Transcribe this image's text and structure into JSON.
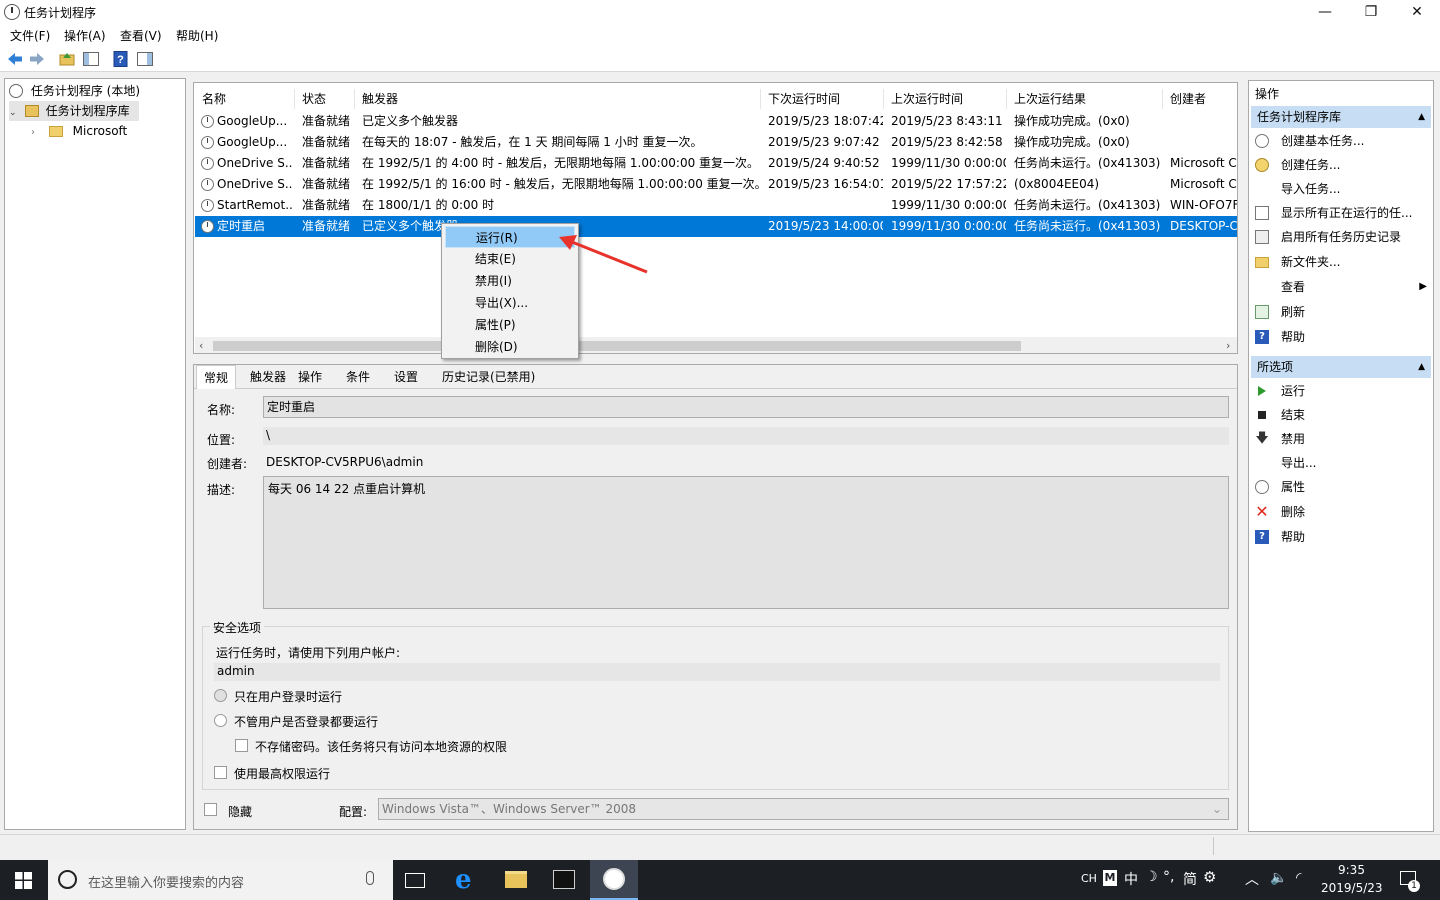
{
  "window": {
    "title": "任务计划程序",
    "min": "—",
    "max": "❐",
    "close": "✕"
  },
  "menu": [
    "文件(F)",
    "操作(A)",
    "查看(V)",
    "帮助(H)"
  ],
  "tree": {
    "root": "任务计划程序 (本地)",
    "library": "任务计划程序库",
    "child": "Microsoft"
  },
  "task_list": {
    "columns": [
      "名称",
      "状态",
      "触发器",
      "下次运行时间",
      "上次运行时间",
      "上次运行结果",
      "创建者"
    ],
    "rows": [
      {
        "name": "GoogleUp...",
        "status": "准备就绪",
        "trigger": "已定义多个触发器",
        "next": "2019/5/23 18:07:42",
        "last": "2019/5/23 8:43:11",
        "result": "操作成功完成。(0x0)",
        "author": ""
      },
      {
        "name": "GoogleUp...",
        "status": "准备就绪",
        "trigger": "在每天的 18:07 - 触发后，在 1 天 期间每隔 1 小时 重复一次。",
        "next": "2019/5/23 9:07:42",
        "last": "2019/5/23 8:42:58",
        "result": "操作成功完成。(0x0)",
        "author": ""
      },
      {
        "name": "OneDrive S...",
        "status": "准备就绪",
        "trigger": "在 1992/5/1 的 4:00 时 - 触发后，无限期地每隔 1.00:00:00 重复一次。",
        "next": "2019/5/24 9:40:52",
        "last": "1999/11/30 0:00:00",
        "result": "任务尚未运行。(0x41303)",
        "author": "Microsoft C"
      },
      {
        "name": "OneDrive S...",
        "status": "准备就绪",
        "trigger": "在 1992/5/1 的 16:00 时 - 触发后，无限期地每隔 1.00:00:00 重复一次。",
        "next": "2019/5/23 16:54:01",
        "last": "2019/5/22 17:57:22",
        "result": "(0x8004EE04)",
        "author": "Microsoft C"
      },
      {
        "name": "StartRemot...",
        "status": "准备就绪",
        "trigger": "在 1800/1/1 的 0:00 时",
        "next": "",
        "last": "1999/11/30 0:00:00",
        "result": "任务尚未运行。(0x41303)",
        "author": "WIN-OFO7F"
      },
      {
        "name": "定时重启",
        "status": "准备就绪",
        "trigger": "已定义多个触发器",
        "next": "2019/5/23 14:00:00",
        "last": "1999/11/30 0:00:00",
        "result": "任务尚未运行。(0x41303)",
        "author": "DESKTOP-C"
      }
    ]
  },
  "context_menu": [
    "运行(R)",
    "结束(E)",
    "禁用(I)",
    "导出(X)...",
    "属性(P)",
    "删除(D)"
  ],
  "detail": {
    "tabs": [
      "常规",
      "触发器",
      "操作",
      "条件",
      "设置",
      "历史记录(已禁用)"
    ],
    "name_label": "名称:",
    "name_value": "定时重启",
    "location_label": "位置:",
    "location_value": "\\",
    "author_label": "创建者:",
    "author_value": "DESKTOP-CV5RPU6\\admin",
    "desc_label": "描述:",
    "desc_value": "每天 06 14 22 点重启计算机",
    "security_title": "安全选项",
    "run_as_label": "运行任务时，请使用下列用户帐户:",
    "run_as_value": "admin",
    "opt_logged_on": "只在用户登录时运行",
    "opt_whether": "不管用户是否登录都要运行",
    "opt_no_password": "不存储密码。该任务将只有访问本地资源的权限",
    "opt_highest": "使用最高权限运行",
    "hidden_label": "隐藏",
    "config_label": "配置:",
    "config_value": "Windows Vista™、Windows Server™ 2008"
  },
  "actions": {
    "title": "操作",
    "section1": "任务计划程序库",
    "items1": [
      "创建基本任务...",
      "创建任务...",
      "导入任务...",
      "显示所有正在运行的任...",
      "启用所有任务历史记录",
      "新文件夹...",
      "查看",
      "刷新",
      "帮助"
    ],
    "section2": "所选项",
    "items2": [
      "运行",
      "结束",
      "禁用",
      "导出...",
      "属性",
      "删除",
      "帮助"
    ]
  },
  "taskbar": {
    "search_placeholder": "在这里输入你要搜索的内容",
    "time": "9:35",
    "date": "2019/5/23",
    "ime": "CH",
    "ime_zh": "中",
    "ime_jian": "简",
    "notif_count": "1"
  }
}
